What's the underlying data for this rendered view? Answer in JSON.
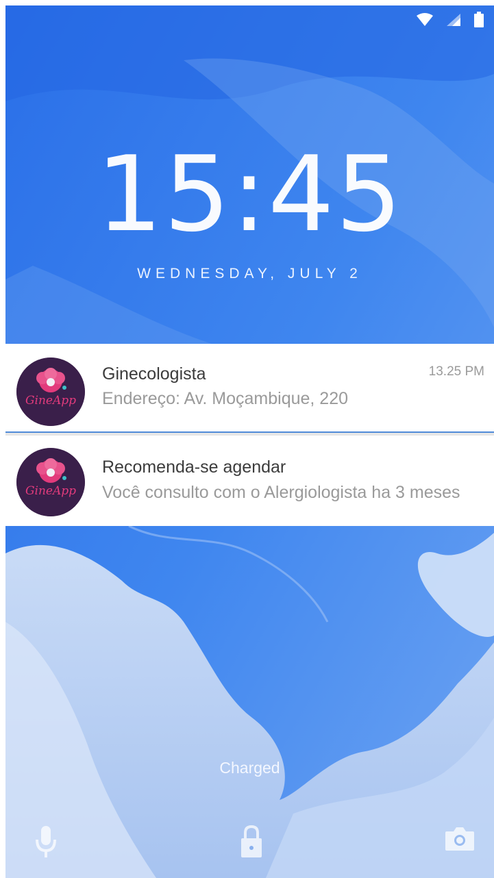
{
  "status_bar": {
    "icons": [
      "wifi-icon",
      "signal-icon",
      "battery-icon"
    ]
  },
  "lockscreen": {
    "time": "15:45",
    "date": "WEDNESDAY, JULY 2",
    "charging_status": "Charged"
  },
  "notifications": [
    {
      "app_icon": "ginecapp-logo",
      "app_logo_text": "GineApp",
      "title": "Ginecologista",
      "text": "Endereço: Av. Moçambique, 220",
      "time": "13.25 PM"
    },
    {
      "app_icon": "ginecapp-logo",
      "app_logo_text": "GineApp",
      "title": "Recomenda-se agendar",
      "text": "Você consulto com o Alergiologista ha 3 meses"
    }
  ],
  "bottom_actions": {
    "icons": [
      "microphone-icon",
      "lock-icon",
      "camera-icon"
    ]
  },
  "colors": {
    "wallpaper_primary": "#3b7ff0",
    "wallpaper_light": "#b9d0f3",
    "notification_bg": "#ffffff",
    "app_icon_bg": "#3a1f4a",
    "app_logo_pink": "#e23b7c"
  }
}
